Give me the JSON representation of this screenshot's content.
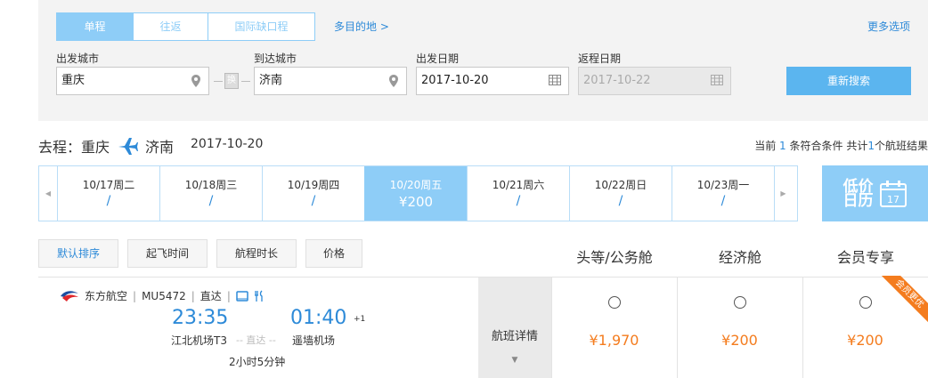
{
  "search": {
    "trip_tabs": [
      "单程",
      "往返",
      "国际缺口程"
    ],
    "multi_link": "多目的地 >",
    "more_options": "更多选项",
    "from_label": "出发城市",
    "from_value": "重庆",
    "swap_label": "换",
    "to_label": "到达城市",
    "to_value": "济南",
    "depart_label": "出发日期",
    "depart_value": "2017-10-20",
    "return_label": "返程日期",
    "return_value": "2017-10-22",
    "research_button": "重新搜索"
  },
  "route": {
    "prefix": "去程：",
    "from": "重庆",
    "to": "济南",
    "date": "2017-10-20",
    "count_text_1": "当前",
    "count_1": "1",
    "count_text_2": "条符合条件 共计",
    "count_2": "1",
    "count_text_3": "个航班结果"
  },
  "date_strip": [
    {
      "label": "10/17周二",
      "price": "/"
    },
    {
      "label": "10/18周三",
      "price": "/"
    },
    {
      "label": "10/19周四",
      "price": "/"
    },
    {
      "label": "10/20周五",
      "price": "¥200"
    },
    {
      "label": "10/21周六",
      "price": "/"
    },
    {
      "label": "10/22周日",
      "price": "/"
    },
    {
      "label": "10/23周一",
      "price": "/"
    }
  ],
  "low_price_calendar": {
    "line1": "低价",
    "line2": "日历",
    "day": "17"
  },
  "sort_buttons": [
    "默认排序",
    "起飞时间",
    "航程时长",
    "价格"
  ],
  "class_headers": [
    "头等/公务舱",
    "经济舱",
    "会员专享"
  ],
  "flight": {
    "airline": "东方航空",
    "flight_no": "MU5472",
    "type": "直达",
    "depart_time": "23:35",
    "arrive_time": "01:40",
    "plus_day": "+1",
    "depart_airport": "江北机场T3",
    "direct_label": "-- 直达 --",
    "arrive_airport": "遥墙机场",
    "duration": "2小时5分钟",
    "detail_label": "航班详情",
    "fares": [
      "¥1,970",
      "¥200",
      "¥200"
    ],
    "member_badge": "会员更优"
  },
  "colors": {
    "accent": "#2d8ad8",
    "light_blue": "#8ecdf7",
    "price_orange": "#f47c1e"
  }
}
